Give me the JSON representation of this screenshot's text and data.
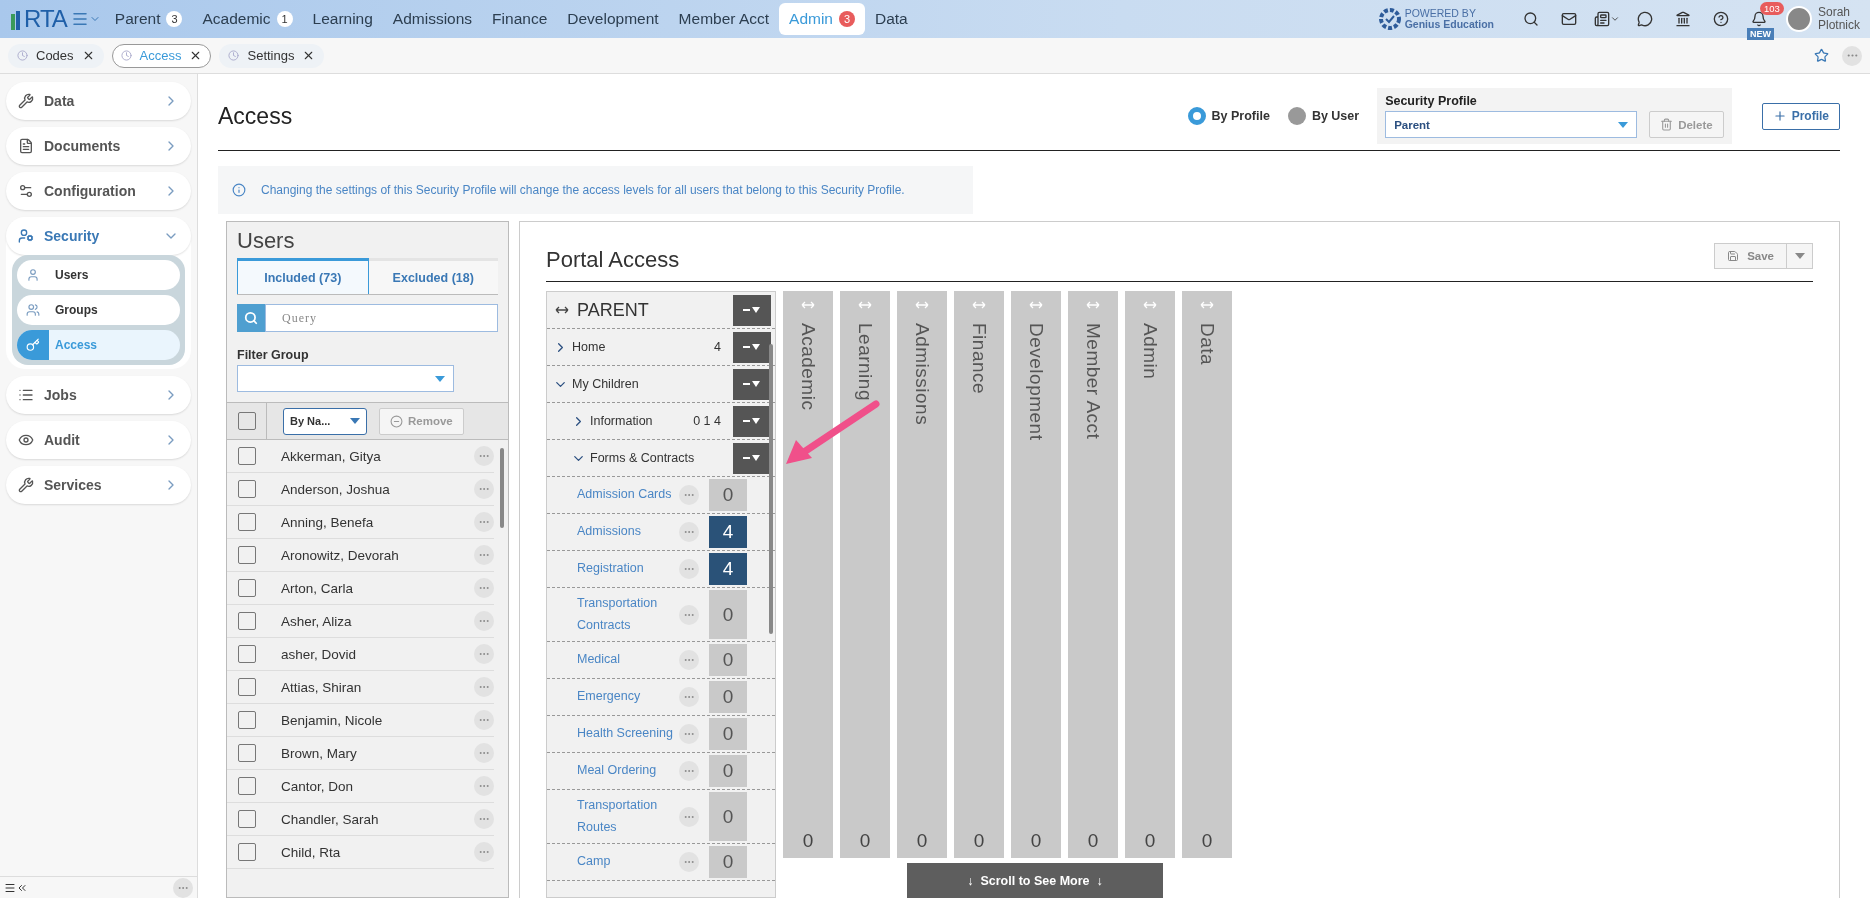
{
  "topbar": {
    "logo": "RTA",
    "nav": [
      {
        "label": "Parent",
        "badge": "3",
        "selected": false
      },
      {
        "label": "Academic",
        "badge": "1",
        "selected": false
      },
      {
        "label": "Learning",
        "selected": false
      },
      {
        "label": "Admissions",
        "selected": false
      },
      {
        "label": "Finance",
        "selected": false
      },
      {
        "label": "Development",
        "selected": false
      },
      {
        "label": "Member Acct",
        "selected": false
      },
      {
        "label": "Admin",
        "badge": "3",
        "selected": true
      },
      {
        "label": "Data",
        "selected": false
      }
    ],
    "powered_by": {
      "line1": "POWERED BY",
      "line2": "Genius Education"
    },
    "notifications": {
      "count": "103",
      "tag": "NEW"
    },
    "user": {
      "first": "Sorah",
      "last": "Plotnick"
    }
  },
  "page_tabs": [
    {
      "label": "Codes",
      "selected": false
    },
    {
      "label": "Access",
      "selected": true
    },
    {
      "label": "Settings",
      "selected": false
    }
  ],
  "sidebar": {
    "items": [
      {
        "label": "Data",
        "expanded": false
      },
      {
        "label": "Documents",
        "expanded": false
      },
      {
        "label": "Configuration",
        "expanded": false
      },
      {
        "label": "Security",
        "expanded": true,
        "children": [
          {
            "label": "Users",
            "selected": false
          },
          {
            "label": "Groups",
            "selected": false
          },
          {
            "label": "Access",
            "selected": true
          }
        ]
      },
      {
        "label": "Jobs",
        "expanded": false
      },
      {
        "label": "Audit",
        "expanded": false
      },
      {
        "label": "Services",
        "expanded": false
      }
    ]
  },
  "header": {
    "title": "Access",
    "modes": [
      {
        "label": "By Profile",
        "selected": true
      },
      {
        "label": "By User",
        "selected": false
      }
    ],
    "profile_label": "Security Profile",
    "profile_value": "Parent",
    "delete_button": "Delete",
    "add_button": "Profile"
  },
  "info": "Changing the settings of this Security Profile will change the access levels for all users that belong to this Security Profile.",
  "users": {
    "title": "Users",
    "tabs": [
      {
        "label": "Included (73)",
        "selected": true
      },
      {
        "label": "Excluded (18)",
        "selected": false
      }
    ],
    "query_placeholder": "Query",
    "filter_label": "Filter Group",
    "sort_value": "By Na...",
    "remove_button": "Remove",
    "all_checked": false,
    "rows": [
      {
        "name": "Akkerman, Gitya",
        "checked": false
      },
      {
        "name": "Anderson, Joshua",
        "checked": false
      },
      {
        "name": "Anning, Benefa",
        "checked": false
      },
      {
        "name": "Aronowitz, Devorah",
        "checked": false
      },
      {
        "name": "Arton, Carla",
        "checked": false
      },
      {
        "name": "Asher, Aliza",
        "checked": false
      },
      {
        "name": "asher, Dovid",
        "checked": false
      },
      {
        "name": "Attias, Shiran",
        "checked": false
      },
      {
        "name": "Benjamin, Nicole",
        "checked": false
      },
      {
        "name": "Brown, Mary",
        "checked": false
      },
      {
        "name": "Cantor, Don",
        "checked": false
      },
      {
        "name": "Chandler, Sarah",
        "checked": false
      },
      {
        "name": "Child, Rta",
        "checked": false
      }
    ]
  },
  "portal": {
    "title": "Portal Access",
    "save_button": "Save",
    "tree_title": "PARENT",
    "tree": [
      {
        "label": "Home",
        "count": "4",
        "expanded": false
      },
      {
        "label": "My Children",
        "expanded": true,
        "children": [
          {
            "label": "Information",
            "count": "0 1 4",
            "expanded": false
          },
          {
            "label": "Forms & Contracts",
            "expanded": true,
            "children": [
              {
                "label": "Admission Cards",
                "value": "0",
                "selected": false
              },
              {
                "label": "Admissions",
                "value": "4",
                "selected": true
              },
              {
                "label": "Registration",
                "value": "4",
                "selected": true
              },
              {
                "label": "Transportation Contracts",
                "value": "0",
                "selected": false
              },
              {
                "label": "Medical",
                "value": "0",
                "selected": false
              },
              {
                "label": "Emergency",
                "value": "0",
                "selected": false
              },
              {
                "label": "Health Screening",
                "value": "0",
                "selected": false
              },
              {
                "label": "Meal Ordering",
                "value": "0",
                "selected": false
              },
              {
                "label": "Transportation Routes",
                "value": "0",
                "selected": false
              },
              {
                "label": "Camp",
                "value": "0",
                "selected": false
              }
            ]
          }
        ]
      }
    ],
    "columns": [
      {
        "label": "Academic",
        "value": "0"
      },
      {
        "label": "Learning",
        "value": "0"
      },
      {
        "label": "Admissions",
        "value": "0"
      },
      {
        "label": "Finance",
        "value": "0"
      },
      {
        "label": "Development",
        "value": "0"
      },
      {
        "label": "Member Acct",
        "value": "0"
      },
      {
        "label": "Admin",
        "value": "0"
      },
      {
        "label": "Data",
        "value": "0"
      }
    ],
    "scroll_hint": "↓  Scroll to See More  ↓"
  }
}
